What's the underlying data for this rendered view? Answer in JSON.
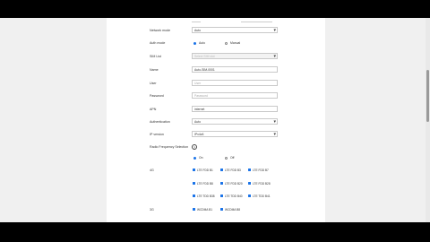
{
  "form": {
    "network_mode": {
      "label": "Network mode",
      "value": "Auto"
    },
    "auth_mode": {
      "label": "Auth mode",
      "options": [
        {
          "label": "Auto",
          "selected": true
        },
        {
          "label": "Manual",
          "selected": false
        }
      ]
    },
    "sim_list": {
      "label": "SIM List",
      "value": "Select SIM slot"
    },
    "name": {
      "label": "Name",
      "value": "Auto-SIM-0001"
    },
    "user": {
      "label": "User",
      "placeholder": "User"
    },
    "password": {
      "label": "Password",
      "placeholder": "Password"
    },
    "apn": {
      "label": "APN",
      "value": "internet"
    },
    "authentication": {
      "label": "Authentication",
      "value": "Auto"
    },
    "pdp_type": {
      "label": "IP version",
      "value": "IPv4v6"
    },
    "band_selection": {
      "label": "Radio Frequency Selection",
      "help_icon": "help-icon",
      "options": [
        {
          "label": "On",
          "selected": true
        },
        {
          "label": "Off",
          "selected": false
        }
      ]
    },
    "lte_bands": {
      "label": "4G",
      "items": [
        {
          "label": "LTE FDD B1",
          "checked": true
        },
        {
          "label": "LTE FDD B3",
          "checked": true
        },
        {
          "label": "LTE FDD B7",
          "checked": true
        },
        {
          "label": "LTE FDD B8",
          "checked": true
        },
        {
          "label": "LTE FDD B20",
          "checked": true
        },
        {
          "label": "LTE FDD B28",
          "checked": true
        },
        {
          "label": "LTE TDD B38",
          "checked": true
        },
        {
          "label": "LTE TDD B40",
          "checked": true
        },
        {
          "label": "LTE TDD B41",
          "checked": true
        }
      ]
    },
    "wcdma_bands": {
      "label": "3G",
      "items": [
        {
          "label": "WCDMA B1",
          "checked": true
        },
        {
          "label": "WCDMA B8",
          "checked": true
        }
      ]
    }
  },
  "colors": {
    "accent": "#1a73e8",
    "panel": "#ffffff",
    "background": "#f0f0f0"
  }
}
